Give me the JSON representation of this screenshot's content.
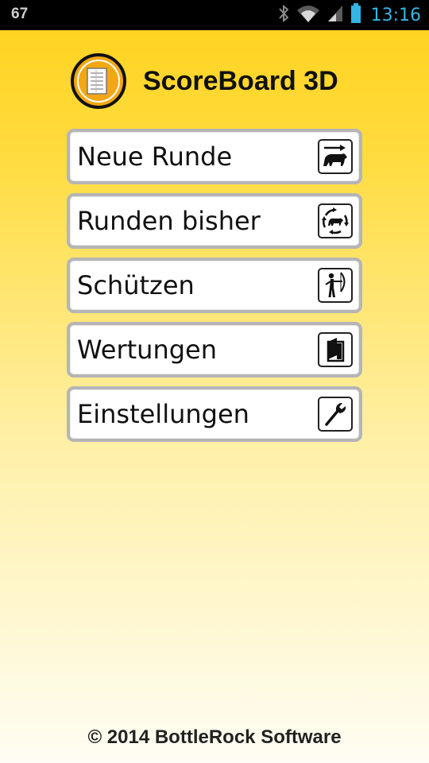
{
  "status_bar": {
    "notification_count": "67",
    "time": "13:16",
    "icons": [
      "bluetooth-icon",
      "wifi-icon",
      "signal-icon",
      "battery-icon"
    ]
  },
  "app": {
    "title": "ScoreBoard 3D"
  },
  "menu": {
    "items": [
      {
        "label": "Neue Runde",
        "icon": "bear-arrow-icon"
      },
      {
        "label": "Runden bisher",
        "icon": "bear-cycle-icon"
      },
      {
        "label": "Schützen",
        "icon": "archer-icon"
      },
      {
        "label": "Wertungen",
        "icon": "book-icon"
      },
      {
        "label": "Einstellungen",
        "icon": "wrench-icon"
      }
    ]
  },
  "footer": {
    "copyright": "©  2014 BottleRock Software"
  },
  "colors": {
    "background_top": "#ffd11a",
    "background_bottom": "#fffdf4",
    "status_time": "#34b5e5",
    "button_border": "#b5b5b5"
  }
}
